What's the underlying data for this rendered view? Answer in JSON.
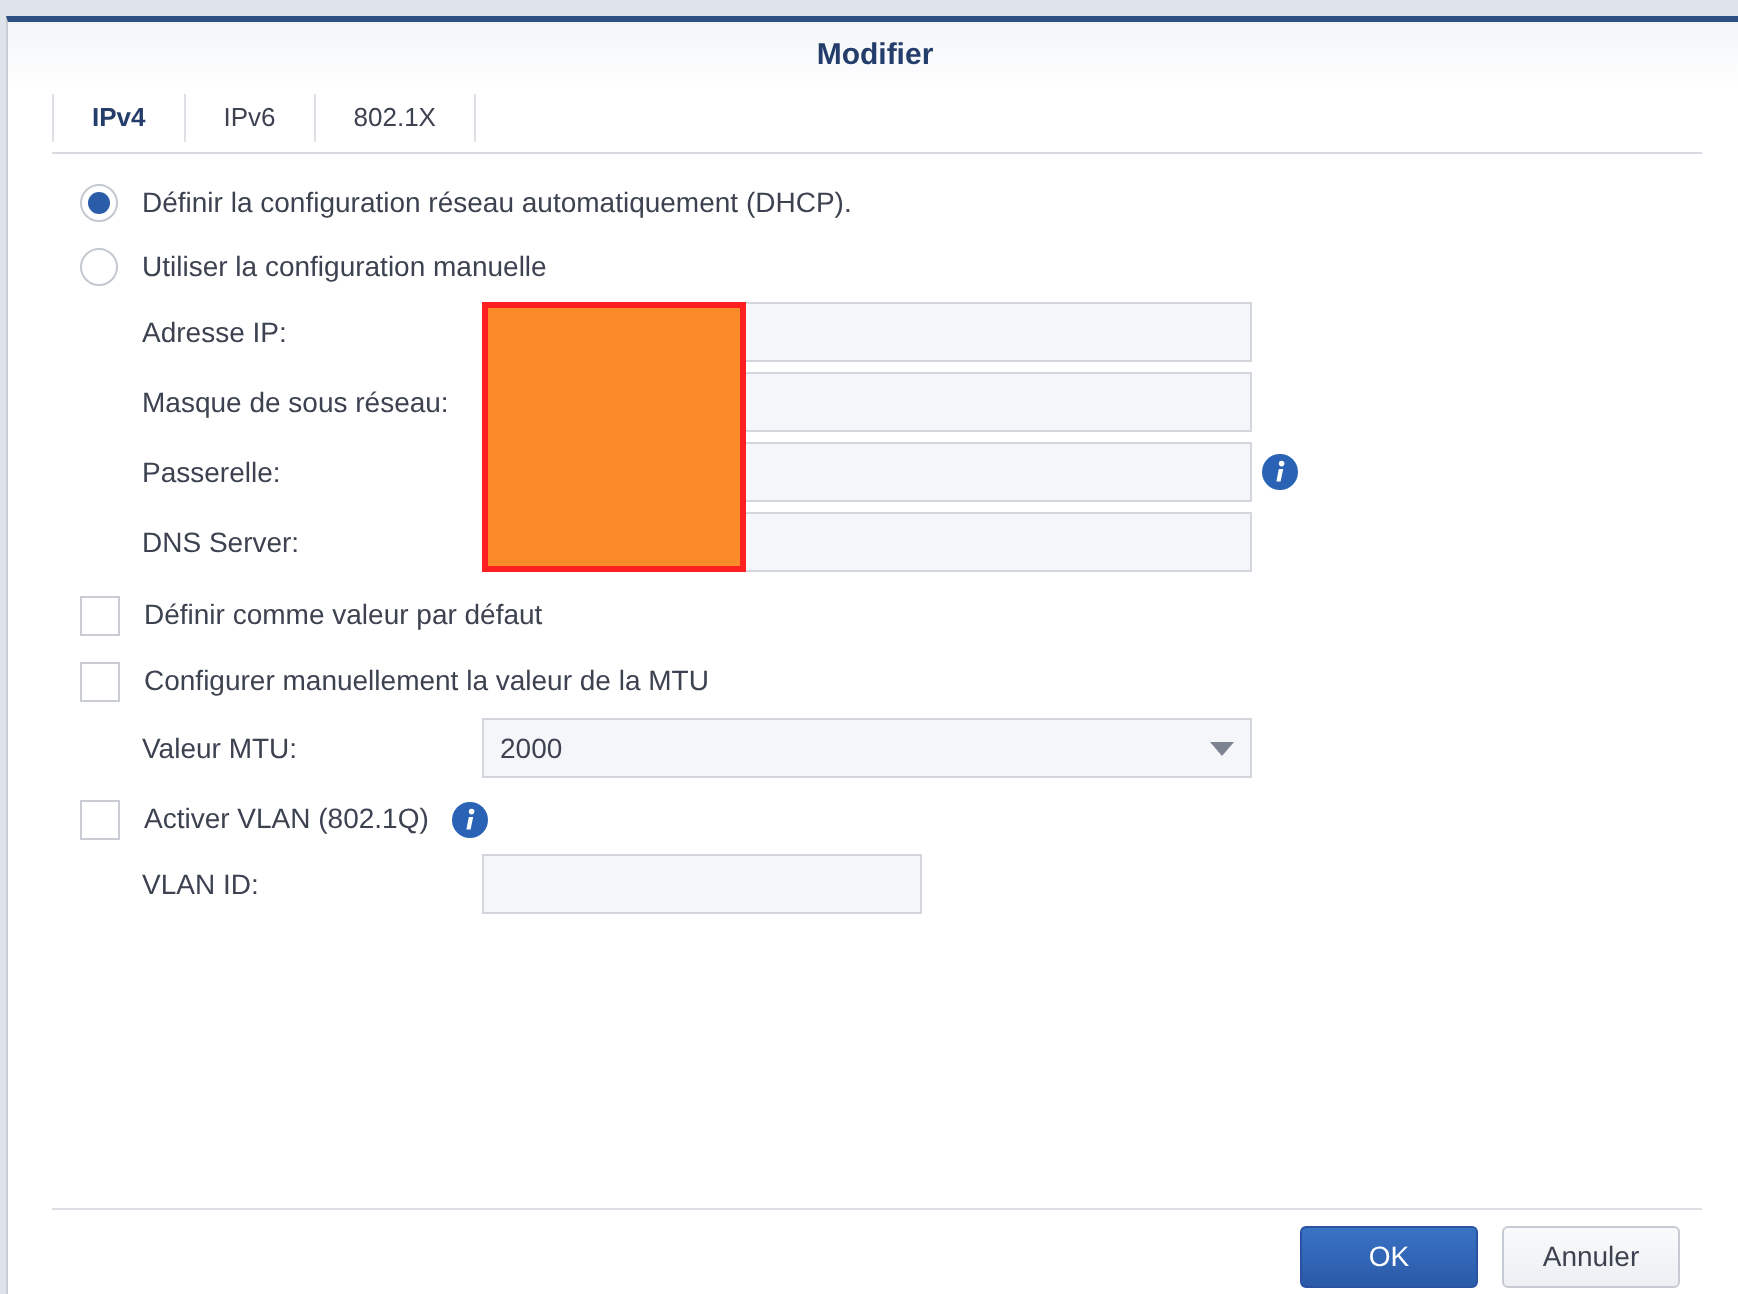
{
  "dialog": {
    "title": "Modifier"
  },
  "tabs": [
    {
      "label": "IPv4",
      "selected": true
    },
    {
      "label": "IPv6",
      "selected": false
    },
    {
      "label": "802.1X",
      "selected": false
    }
  ],
  "modes": [
    {
      "label": "Définir la configuration réseau automatiquement (DHCP).",
      "selected": true
    },
    {
      "label": "Utiliser la configuration manuelle",
      "selected": false
    }
  ],
  "ip_fields": [
    {
      "label": "Adresse IP:",
      "info": false
    },
    {
      "label": "Masque de sous réseau:",
      "info": false
    },
    {
      "label": "Passerelle:",
      "info": true
    },
    {
      "label": "DNS Server:",
      "info": false
    }
  ],
  "default_option": {
    "label": "Définir comme valeur par défaut",
    "checked": false
  },
  "mtu_option": {
    "label": "Configurer manuellement la valeur de la MTU",
    "checked": false
  },
  "mtu": {
    "label": "Valeur MTU:",
    "value": "2000"
  },
  "vlan_option": {
    "label": "Activer VLAN (802.1Q)",
    "checked": false,
    "info": true
  },
  "vlan_id": {
    "label": "VLAN ID:"
  },
  "buttons": [
    {
      "label": "OK",
      "kind": "primary"
    },
    {
      "label": "Annuler",
      "kind": "secondary"
    }
  ]
}
